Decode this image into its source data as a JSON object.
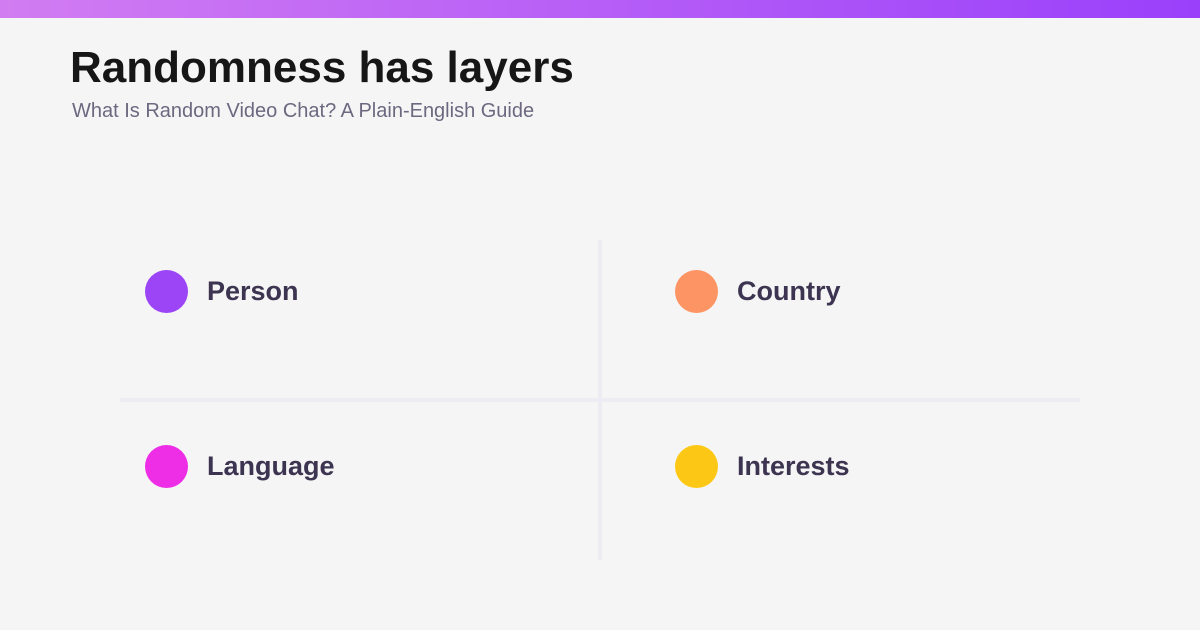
{
  "header": {
    "title": "Randomness has layers",
    "subtitle": "What Is Random Video Chat? A Plain-English Guide"
  },
  "accent_gradient": [
    "#d27cf2",
    "#9a40fb"
  ],
  "layers": [
    {
      "label": "Person",
      "color": "#9b45f7"
    },
    {
      "label": "Country",
      "color": "#fd9464"
    },
    {
      "label": "Language",
      "color": "#ee2ee6"
    },
    {
      "label": "Interests",
      "color": "#fdc815"
    }
  ]
}
